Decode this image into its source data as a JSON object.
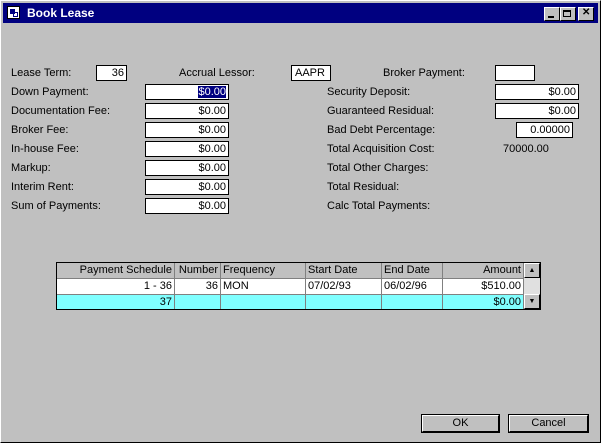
{
  "window": {
    "title": "Book Lease"
  },
  "top_row": {
    "lease_term_label": "Lease Term:",
    "lease_term_value": "36",
    "accrual_lessor_label": "Accrual Lessor:",
    "accrual_lessor_value": "AAPR",
    "broker_payment_label": "Broker Payment:",
    "broker_payment_value": ""
  },
  "left_fields": [
    {
      "label": "Down Payment:",
      "value": "$0.00"
    },
    {
      "label": "Documentation Fee:",
      "value": "$0.00"
    },
    {
      "label": "Broker Fee:",
      "value": "$0.00"
    },
    {
      "label": "In-house Fee:",
      "value": "$0.00"
    },
    {
      "label": "Markup:",
      "value": "$0.00"
    },
    {
      "label": "Interim Rent:",
      "value": "$0.00"
    },
    {
      "label": "Sum of Payments:",
      "value": "$0.00"
    }
  ],
  "right_fields": [
    {
      "label": "Security Deposit:",
      "value": "$0.00"
    },
    {
      "label": "Guaranteed Residual:",
      "value": "$0.00"
    },
    {
      "label": "Bad Debt Percentage:",
      "value": "0.00000"
    },
    {
      "label": "Total Acquisition Cost:",
      "value": "70000.00"
    },
    {
      "label": "Total Other Charges:",
      "value": ""
    },
    {
      "label": "Total Residual:",
      "value": ""
    },
    {
      "label": "Calc Total Payments:",
      "value": ""
    }
  ],
  "schedule": {
    "headers": [
      "Payment Schedule",
      "Number",
      "Frequency",
      "Start Date",
      "End Date",
      "Amount"
    ],
    "rows": [
      [
        "1 -  36",
        "36",
        "MON",
        "07/02/93",
        "06/02/96",
        "$510.00"
      ],
      [
        "37",
        "",
        "",
        "",
        "",
        "$0.00"
      ]
    ]
  },
  "buttons": {
    "ok": "OK",
    "cancel": "Cancel"
  },
  "colors": {
    "titlebar": "#000080",
    "highlight_row": "#80ffff",
    "face": "#c0c0c0"
  }
}
